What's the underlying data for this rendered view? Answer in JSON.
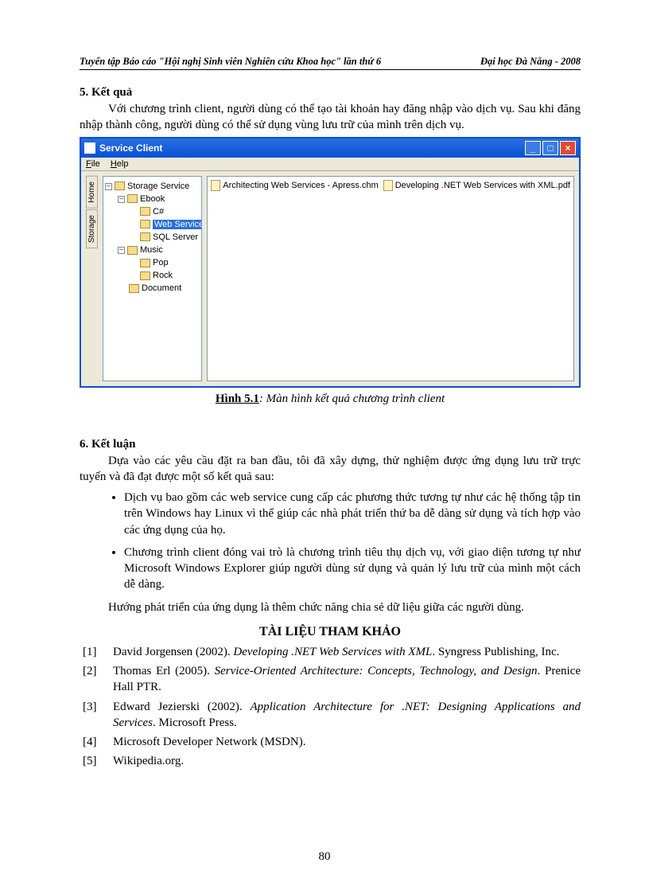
{
  "header": {
    "left": "Tuyển tập Báo cáo \"Hội nghị Sinh viên Nghiên cứu Khoa học\" lần thứ 6",
    "right": "Đại học Đà Nẵng - 2008"
  },
  "sec5": {
    "title": "5. Kết quả",
    "para": "Với chương trình client, người dùng có thể tạo tài khoản hay đăng nhập vào dịch vụ. Sau khi đăng nhập thành công, người dùng có thể sử dụng vùng lưu trữ của mình trên dịch vụ."
  },
  "window": {
    "title": "Service Client",
    "btn_min": "_",
    "btn_max": "□",
    "btn_close": "×",
    "menu": {
      "file": "File",
      "help": "Help"
    },
    "vtabs": [
      "Home",
      "Storage"
    ],
    "tree": {
      "root": "Storage Service",
      "ebook": "Ebook",
      "csharp": "C#",
      "web": "Web Services",
      "sql": "SQL Server",
      "music": "Music",
      "pop": "Pop",
      "rock": "Rock",
      "doc": "Document"
    },
    "files": [
      "Architecting Web Services - Apress.chm",
      "Developing .NET Web Services with XML.pdf"
    ]
  },
  "fig": {
    "label": "Hình 5.1",
    "caption": ": Màn hình kết quả chương trình client"
  },
  "sec6": {
    "title": "6. Kết luận",
    "para": "Dựa vào các yêu cầu đặt ra ban đầu, tôi đã xây dựng, thử nghiệm được ứng dụng lưu trữ trực tuyến và đã đạt được một số kết quả sau:",
    "bullets": [
      "Dịch vụ bao gồm các web service cung cấp các phương thức tương tự như các hệ thống tập tin trên Windows hay Linux vì thế giúp các nhà phát triển thứ ba dễ dàng sử dụng và tích hợp vào các ứng dụng của họ.",
      "Chương trình client đóng vai trò là chương trình tiêu thụ dịch vụ, với giao diện tương tự như Microsoft Windows Explorer giúp người dùng sử dụng và quản lý lưu trữ của mình một cách dễ dàng."
    ],
    "closing": "Hướng phát triển của ứng dụng là thêm chức năng chia sẻ dữ liệu giữa các người dùng."
  },
  "refs": {
    "title": "TÀI LIỆU THAM KHẢO",
    "items": [
      {
        "n": "[1]",
        "pre": "David Jorgensen (2002). ",
        "it": "Developing .NET Web Services with XML",
        "post": ". Syngress Publishing, Inc."
      },
      {
        "n": "[2]",
        "pre": "Thomas Erl (2005). ",
        "it": "Service-Oriented Architecture: Concepts, Technology, and Design",
        "post": ". Prenice Hall PTR."
      },
      {
        "n": "[3]",
        "pre": "Edward Jezierski (2002). ",
        "it": "Application Architecture for .NET: Designing Applications and Services",
        "post": ". Microsoft Press."
      },
      {
        "n": "[4]",
        "pre": "Microsoft Developer Network (MSDN).",
        "it": "",
        "post": ""
      },
      {
        "n": "[5]",
        "pre": "Wikipedia.org.",
        "it": "",
        "post": ""
      }
    ]
  },
  "pagenum": "80"
}
